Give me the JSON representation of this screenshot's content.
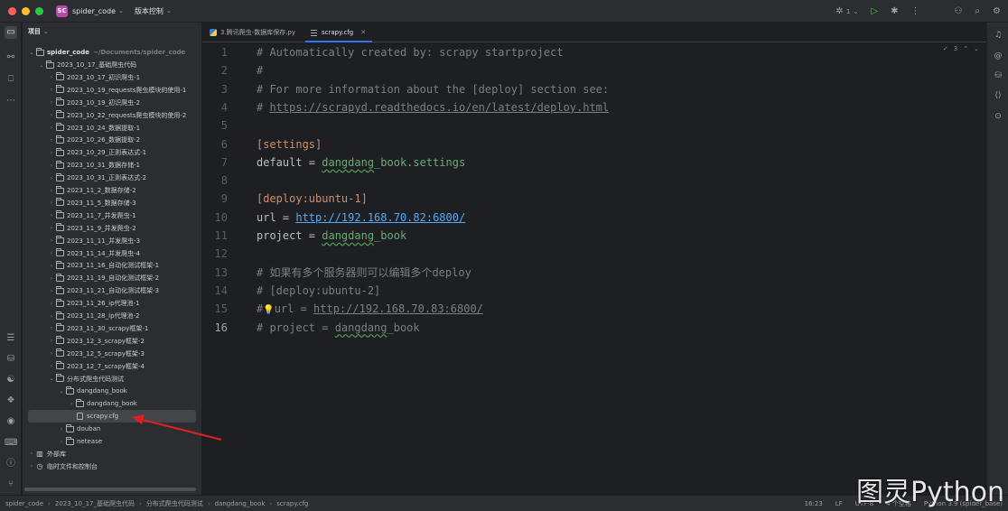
{
  "titlebar": {
    "project_badge": "SC",
    "project_name": "spider_code",
    "vcs_label": "版本控制",
    "run_config_count": "1"
  },
  "project_panel": {
    "title": "项目",
    "root": {
      "name": "spider_code",
      "path": "~/Documents/spider_code"
    },
    "items": [
      {
        "label": "2023_10_17_基础爬虫代码",
        "depth": 1,
        "type": "folder",
        "open": true
      },
      {
        "label": "2023_10_17_初识爬虫-1",
        "depth": 2,
        "type": "folder"
      },
      {
        "label": "2023_10_19_requests爬虫模块的使用-1",
        "depth": 2,
        "type": "folder"
      },
      {
        "label": "2023_10_19_初识爬虫-2",
        "depth": 2,
        "type": "folder"
      },
      {
        "label": "2023_10_22_requests爬虫模块的使用-2",
        "depth": 2,
        "type": "folder"
      },
      {
        "label": "2023_10_24_数据提取-1",
        "depth": 2,
        "type": "folder"
      },
      {
        "label": "2023_10_26_数据提取-2",
        "depth": 2,
        "type": "folder"
      },
      {
        "label": "2023_10_29_正则表达式-1",
        "depth": 2,
        "type": "folder"
      },
      {
        "label": "2023_10_31_数据存储-1",
        "depth": 2,
        "type": "folder"
      },
      {
        "label": "2023_10_31_正则表达式-2",
        "depth": 2,
        "type": "folder"
      },
      {
        "label": "2023_11_2_数据存储-2",
        "depth": 2,
        "type": "folder"
      },
      {
        "label": "2023_11_5_数据存储-3",
        "depth": 2,
        "type": "folder"
      },
      {
        "label": "2023_11_7_并发爬虫-1",
        "depth": 2,
        "type": "folder"
      },
      {
        "label": "2023_11_9_并发爬虫-2",
        "depth": 2,
        "type": "folder"
      },
      {
        "label": "2023_11_11_并发爬虫-3",
        "depth": 2,
        "type": "folder"
      },
      {
        "label": "2023_11_14_并发爬虫-4",
        "depth": 2,
        "type": "folder"
      },
      {
        "label": "2023_11_16_自动化测试框架-1",
        "depth": 2,
        "type": "folder"
      },
      {
        "label": "2023_11_19_自动化测试框架-2",
        "depth": 2,
        "type": "folder"
      },
      {
        "label": "2023_11_21_自动化测试框架-3",
        "depth": 2,
        "type": "folder"
      },
      {
        "label": "2023_11_26_ip代理池-1",
        "depth": 2,
        "type": "folder"
      },
      {
        "label": "2023_11_28_ip代理池-2",
        "depth": 2,
        "type": "folder"
      },
      {
        "label": "2023_11_30_scrapy框架-1",
        "depth": 2,
        "type": "folder"
      },
      {
        "label": "2023_12_3_scrapy框架-2",
        "depth": 2,
        "type": "folder"
      },
      {
        "label": "2023_12_5_scrapy框架-3",
        "depth": 2,
        "type": "folder"
      },
      {
        "label": "2023_12_7_scrapy框架-4",
        "depth": 2,
        "type": "folder"
      },
      {
        "label": "分布式爬虫代码测试",
        "depth": 2,
        "type": "folder",
        "open": true
      },
      {
        "label": "dangdang_book",
        "depth": 3,
        "type": "folder",
        "open": true
      },
      {
        "label": "dangdang_book",
        "depth": 4,
        "type": "folder"
      },
      {
        "label": "scrapy.cfg",
        "depth": 4,
        "type": "file",
        "selected": true
      },
      {
        "label": "douban",
        "depth": 3,
        "type": "folder"
      },
      {
        "label": "netease",
        "depth": 3,
        "type": "folder"
      },
      {
        "label": "外部库",
        "depth": 0,
        "type": "lib"
      },
      {
        "label": "临时文件和控制台",
        "depth": 0,
        "type": "scratch"
      }
    ]
  },
  "tabs": [
    {
      "label": "3.腾讯爬虫-数据库保存.py",
      "icon": "python-file-icon",
      "active": false
    },
    {
      "label": "scrapy.cfg",
      "icon": "config-file-icon",
      "active": true
    }
  ],
  "editor": {
    "inspection_count": "3",
    "current_line": 16,
    "lines": [
      {
        "n": "1",
        "parts": [
          [
            "c-com",
            "# Automatically created by: scrapy startproject"
          ]
        ]
      },
      {
        "n": "2",
        "parts": [
          [
            "c-com",
            "#"
          ]
        ]
      },
      {
        "n": "3",
        "parts": [
          [
            "c-com",
            "# For more information about the [deploy] section see:"
          ]
        ]
      },
      {
        "n": "4",
        "parts": [
          [
            "c-com",
            "# "
          ],
          [
            "c-url-com",
            "https://scrapyd.readthedocs.io/en/latest/deploy.html"
          ]
        ]
      },
      {
        "n": "5",
        "parts": []
      },
      {
        "n": "6",
        "parts": [
          [
            "c-sec",
            "[settings]"
          ]
        ]
      },
      {
        "n": "7",
        "parts": [
          [
            "c-key",
            "default = "
          ],
          [
            "c-val c-squig",
            "dangdang"
          ],
          [
            "c-val",
            "_book.settings"
          ]
        ]
      },
      {
        "n": "8",
        "parts": []
      },
      {
        "n": "9",
        "parts": [
          [
            "c-sec",
            "[deploy:ubuntu-1]"
          ]
        ]
      },
      {
        "n": "10",
        "parts": [
          [
            "c-key",
            "url = "
          ],
          [
            "c-url",
            "http://192.168.70.82:6800/"
          ]
        ]
      },
      {
        "n": "11",
        "parts": [
          [
            "c-key",
            "project = "
          ],
          [
            "c-val c-squig",
            "dangdang"
          ],
          [
            "c-val",
            "_book"
          ]
        ]
      },
      {
        "n": "12",
        "parts": []
      },
      {
        "n": "13",
        "parts": [
          [
            "c-com",
            "# 如果有多个服务器则可以编辑多个deploy"
          ]
        ]
      },
      {
        "n": "14",
        "parts": [
          [
            "c-com",
            "# [deploy:ubuntu-2]"
          ]
        ]
      },
      {
        "n": "15",
        "parts": [
          [
            "c-com",
            "#"
          ],
          [
            "gutter-bulb",
            "💡"
          ],
          [
            "c-com",
            "url = "
          ],
          [
            "c-url-com",
            "http://192.168.70.83:6800/"
          ]
        ]
      },
      {
        "n": "16",
        "parts": [
          [
            "c-com",
            "# project = "
          ],
          [
            "c-com c-squig",
            "dangdang"
          ],
          [
            "c-com",
            "_book"
          ]
        ]
      }
    ]
  },
  "statusbar": {
    "breadcrumbs": [
      "spider_code",
      "2023_10_17_基础爬虫代码",
      "分布式爬虫代码测试",
      "dangdang_book",
      "scrapy.cfg"
    ],
    "position": "16:23",
    "line_sep": "LF",
    "encoding": "UTF-8",
    "indent": "4 个空格",
    "interpreter": "Python 3.9 (spider_base)"
  },
  "watermark": "图灵Python",
  "colors": {
    "accent": "#3574f0",
    "background": "#1e1f22",
    "panel": "#2b2d30",
    "selection": "#43454a",
    "arrow": "#e02020"
  }
}
